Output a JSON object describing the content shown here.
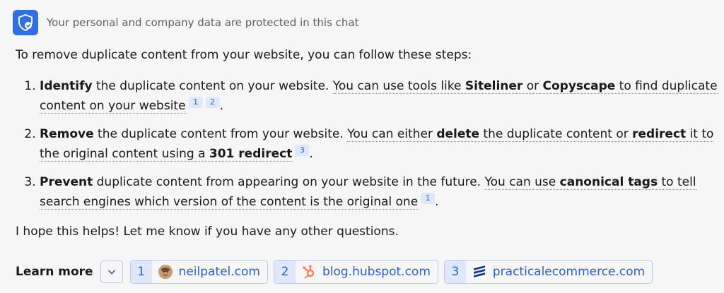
{
  "header": {
    "notice": "Your personal and company data are protected in this chat"
  },
  "intro": "To remove duplicate content from your website, you can follow these steps:",
  "steps": [
    {
      "bold": "Identify",
      "rest": " the duplicate content on your website.",
      "sent_a": "You can use tools like ",
      "tool1": "Siteliner",
      "or": " or ",
      "tool2": "Copyscape",
      "sent_b": " to find duplicate content on your website",
      "cites": [
        "1",
        "2"
      ]
    },
    {
      "bold": "Remove",
      "rest": " the duplicate content from your website.",
      "sent_a": "You can either ",
      "b1": "delete",
      "mid": " the duplicate content or ",
      "b2": "redirect",
      "mid2": " it to the original content using a ",
      "b3": "301 redirect",
      "cites": [
        "3"
      ]
    },
    {
      "bold": "Prevent",
      "rest": " duplicate content from appearing on your website in the future.",
      "sent_a": "You can use ",
      "b1": "canonical tags",
      "sent_b": " to tell search engines which version of the content is the original one",
      "cites": [
        "1"
      ]
    }
  ],
  "outro": "I hope this helps! Let me know if you have any other questions.",
  "learn_more": {
    "label": "Learn more",
    "sources": [
      {
        "num": "1",
        "name": "neilpatel.com",
        "icon": "avatar-icon"
      },
      {
        "num": "2",
        "name": "blog.hubspot.com",
        "icon": "hubspot-icon",
        "color": "#ff7a59"
      },
      {
        "num": "3",
        "name": "practicalecommerce.com",
        "icon": "practical-ecommerce-icon",
        "color": "#1e3f8f"
      }
    ]
  },
  "colors": {
    "accent": "#2f6fe0",
    "link": "#2a5fcf",
    "chip_bg": "#dfe8fb"
  }
}
